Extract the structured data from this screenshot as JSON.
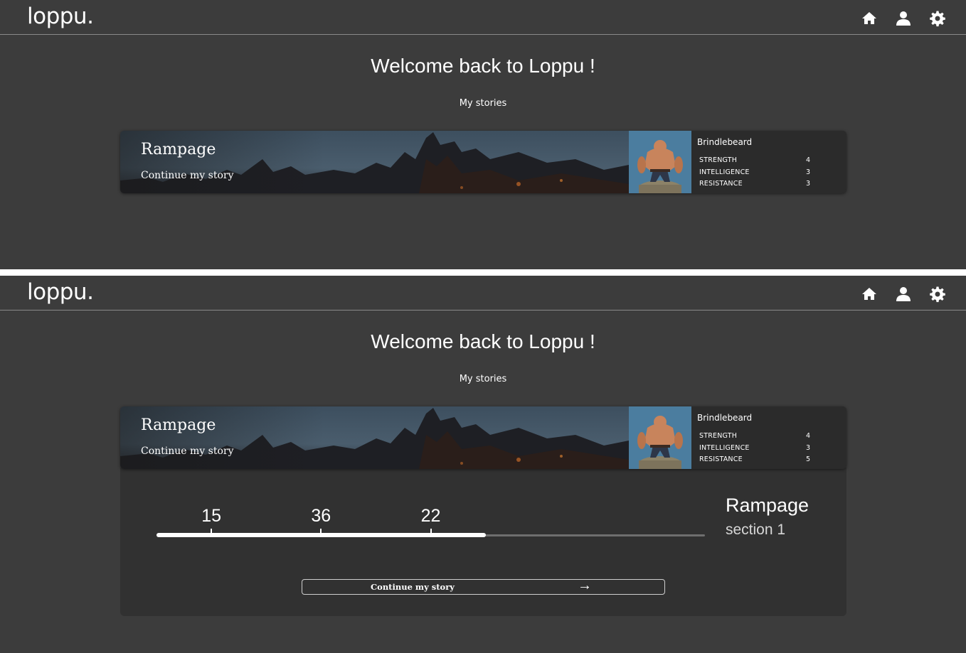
{
  "app": {
    "logo": "loppu.",
    "welcome": "Welcome back to Loppu !",
    "section_title": "My stories"
  },
  "icons": {
    "nav": [
      "home-icon",
      "user-icon",
      "settings-icon"
    ],
    "color": "#ffffff"
  },
  "screens": [
    {
      "story": {
        "title": "Rampage",
        "continue_label": "Continue my story"
      },
      "character": {
        "name": "Brindlebeard",
        "stats": [
          {
            "label": "STRENGTH",
            "value": "4"
          },
          {
            "label": "INTELLIGENCE",
            "value": "3"
          },
          {
            "label": "RESISTANCE",
            "value": "3"
          }
        ]
      }
    },
    {
      "story": {
        "title": "Rampage",
        "continue_label": "Continue my story"
      },
      "character": {
        "name": "Brindlebeard",
        "stats": [
          {
            "label": "STRENGTH",
            "value": "4"
          },
          {
            "label": "INTELLIGENCE",
            "value": "3"
          },
          {
            "label": "RESISTANCE",
            "value": "5"
          }
        ]
      },
      "progress": {
        "fraction": 0.6,
        "checkpoints": [
          {
            "label": "15",
            "position": 0.1
          },
          {
            "label": "36",
            "position": 0.3
          },
          {
            "label": "22",
            "position": 0.5
          }
        ],
        "story_title": "Rampage",
        "section_label": "section 1",
        "button_label": "Continue my story",
        "button_arrow": "→"
      }
    }
  ]
}
